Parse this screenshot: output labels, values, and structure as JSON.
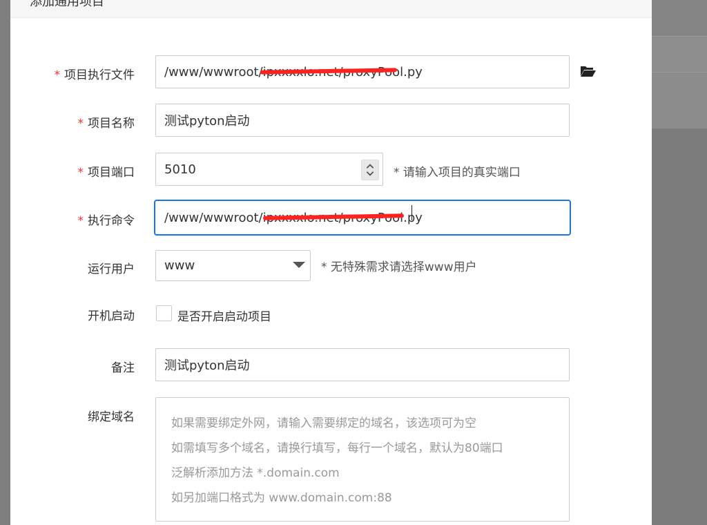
{
  "dialog": {
    "title": "添加通用项目"
  },
  "form": {
    "exec_file": {
      "label": "项目执行文件",
      "value": "/www/wwwroot/ipxxxxlo.net/proxyPool.py"
    },
    "project_name": {
      "label": "项目名称",
      "value": "测试pyton启动"
    },
    "project_port": {
      "label": "项目端口",
      "value": "5010",
      "hint": "* 请输入项目的真实端口"
    },
    "exec_command": {
      "label": "执行命令",
      "value": "/www/wwwroot/ipxxxxlo.net/proxyPool.py"
    },
    "run_user": {
      "label": "运行用户",
      "value": "www",
      "hint": "* 无特殊需求请选择www用户"
    },
    "autostart": {
      "label": "开机启动",
      "checkbox_label": "是否开启启动项目",
      "checked": false
    },
    "remark": {
      "label": "备注",
      "value": "测试pyton启动"
    },
    "bind_domain": {
      "label": "绑定域名",
      "placeholder_lines": [
        "如果需要绑定外网，请输入需要绑定的域名，该选项可为空",
        "如需填写多个域名，请换行填写，每行一个域名，默认为80端口",
        "泛解析添加方法 *.domain.com",
        "如另加端口格式为 www.domain.com:88"
      ]
    }
  },
  "colors": {
    "required": "#e33333",
    "focus_border": "#1677e0",
    "redaction": "#ff2222"
  },
  "icons": {
    "folder": "folder-open-icon"
  }
}
